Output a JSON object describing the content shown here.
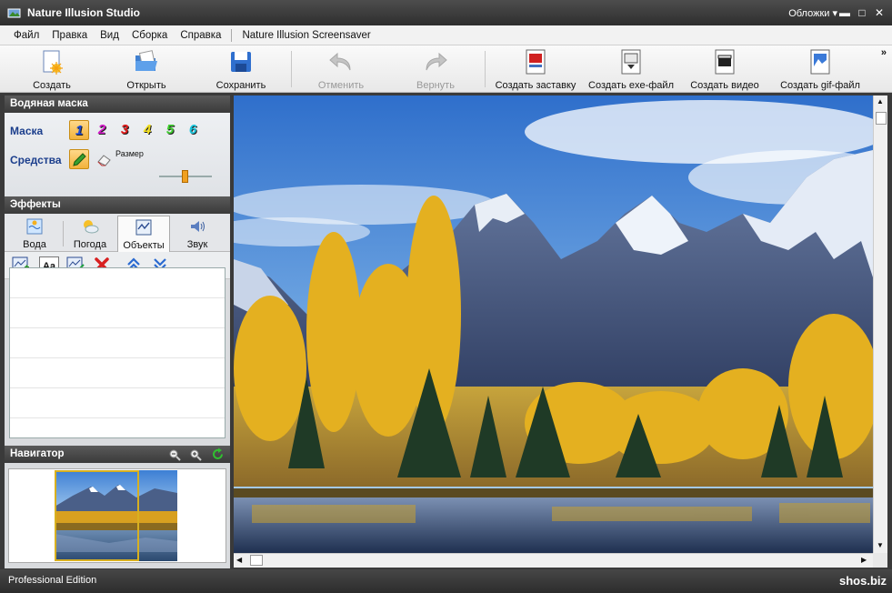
{
  "window": {
    "title": "Nature Illusion Studio",
    "skins_label": "Обложки",
    "skins_chevron": "▾",
    "minimize": "▬",
    "maximize": "□",
    "close": "✕"
  },
  "menu": {
    "items": [
      "Файл",
      "Правка",
      "Вид",
      "Сборка",
      "Справка"
    ],
    "screensaver": "Nature Illusion Screensaver"
  },
  "toolbar": {
    "create": "Создать",
    "open": "Открыть",
    "save": "Сохранить",
    "undo": "Отменить",
    "redo": "Вернуть",
    "make_screensaver": "Создать заставку",
    "make_exe": "Создать exe-файл",
    "make_video": "Создать видео",
    "make_gif": "Создать gif-файл",
    "more": "»"
  },
  "watermark": {
    "title": "Водяная маска",
    "mask_label": "Маска",
    "tools_label": "Средства",
    "size_label": "Размер",
    "masks": [
      {
        "n": "1",
        "color": "#1c4cd8"
      },
      {
        "n": "2",
        "color": "#d21ac8"
      },
      {
        "n": "3",
        "color": "#e01818"
      },
      {
        "n": "4",
        "color": "#f2e020"
      },
      {
        "n": "5",
        "color": "#40d030"
      },
      {
        "n": "6",
        "color": "#18c8e0"
      }
    ],
    "active_mask": "1"
  },
  "effects": {
    "title": "Эффекты",
    "tabs": [
      "Вода",
      "Погода",
      "Объекты",
      "Звук"
    ],
    "active_tab": "Объекты"
  },
  "navigator": {
    "title": "Навигатор"
  },
  "status": {
    "edition": "Professional Edition",
    "site": "shos.biz"
  },
  "colors": {
    "accent": "#f2b23b",
    "header": "#3a3a3a",
    "mask_label": "#1b3e8c"
  }
}
